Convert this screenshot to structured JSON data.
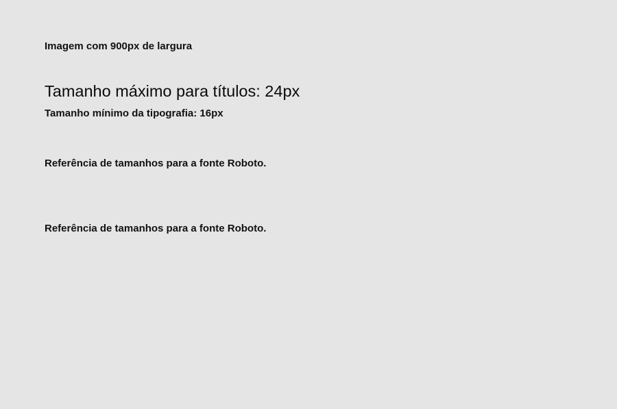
{
  "background_color": "#e5e5e5",
  "lines": {
    "width_note": "Imagem com 900px de largura",
    "max_title": "Tamanho máximo para títulos: 24px",
    "min_type": "Tamanho mínimo da tipografia: 16px",
    "reference_1": "Referência de tamanhos para a fonte Roboto.",
    "reference_2": "Referência de tamanhos para a fonte Roboto."
  }
}
